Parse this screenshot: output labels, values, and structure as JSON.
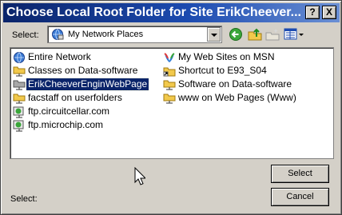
{
  "window": {
    "title": "Choose Local Root Folder for Site ErikCheever...",
    "help_button": "?",
    "close_button": "X"
  },
  "location_bar": {
    "label": "Select:",
    "current_location": "My Network Places",
    "location_icon": "network-places-icon"
  },
  "toolbar": {
    "buttons": [
      "back-icon",
      "up-folder-icon",
      "new-folder-icon",
      "view-menu-icon"
    ]
  },
  "items": [
    {
      "label": "Entire Network",
      "icon": "entire-network-icon"
    },
    {
      "label": "Classes on Data-software",
      "icon": "network-folder-icon"
    },
    {
      "label": "ErikCheeverEnginWebPage",
      "icon": "network-folder-icon",
      "selected": true
    },
    {
      "label": "facstaff on userfolders",
      "icon": "network-folder-icon"
    },
    {
      "label": "ftp.circuitcellar.com",
      "icon": "ftp-site-icon"
    },
    {
      "label": "ftp.microchip.com",
      "icon": "ftp-site-icon"
    },
    {
      "label": "My Web Sites on MSN",
      "icon": "msn-icon"
    },
    {
      "label": "Shortcut to E93_S04",
      "icon": "folder-shortcut-icon"
    },
    {
      "label": "Software on Data-software",
      "icon": "network-folder-icon"
    },
    {
      "label": "www on Web Pages (Www)",
      "icon": "network-folder-icon"
    }
  ],
  "footer": {
    "label": "Select:",
    "select_button": "Select",
    "cancel_button": "Cancel"
  },
  "colors": {
    "title_bar": "#0a246a",
    "selection": "#0a246a",
    "dialog_face": "#d4d0c8"
  }
}
